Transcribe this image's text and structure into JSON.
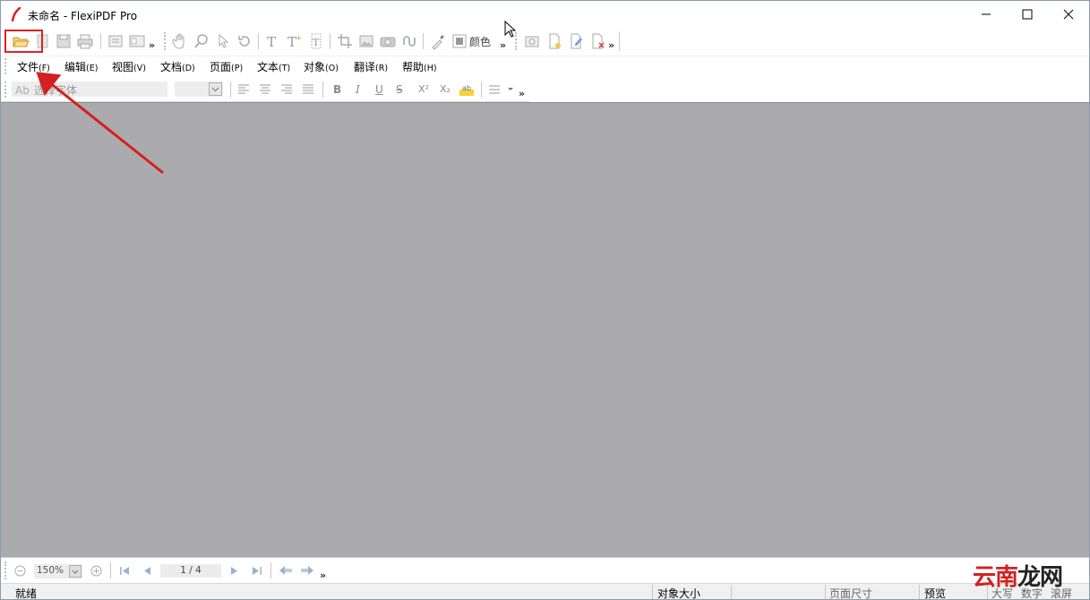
{
  "window": {
    "title": "未命名 - FlexiPDF Pro"
  },
  "toolbar": {
    "color_label": "颜色",
    "overflow": "»"
  },
  "menu": [
    {
      "label": "文件",
      "accel": "(F)"
    },
    {
      "label": "编辑",
      "accel": "(E)"
    },
    {
      "label": "视图",
      "accel": "(V)"
    },
    {
      "label": "文档",
      "accel": "(D)"
    },
    {
      "label": "页面",
      "accel": "(P)"
    },
    {
      "label": "文本",
      "accel": "(T)"
    },
    {
      "label": "对象",
      "accel": "(O)"
    },
    {
      "label": "翻译",
      "accel": "(R)"
    },
    {
      "label": "帮助",
      "accel": "(H)"
    }
  ],
  "format": {
    "font_placeholder": "选择字体",
    "font_prefix": "Ab",
    "bold": "B",
    "italic": "I",
    "underline": "U",
    "strike": "S",
    "superscript": "X²",
    "subscript": "X₂",
    "overflow": "»"
  },
  "nav": {
    "zoom": "150%",
    "page": "1 / 4",
    "overflow": "»"
  },
  "status": {
    "ready": "就绪",
    "object_size": "对象大小",
    "page_size": "页面尺寸",
    "preview": "预览",
    "caps": "大写",
    "num": "数字",
    "scroll": "滚屏"
  },
  "watermark": {
    "text_a": "云南",
    "text_b": "龙网"
  },
  "colors": {
    "canvas": "#abaaad",
    "highlight": "#e02020"
  }
}
